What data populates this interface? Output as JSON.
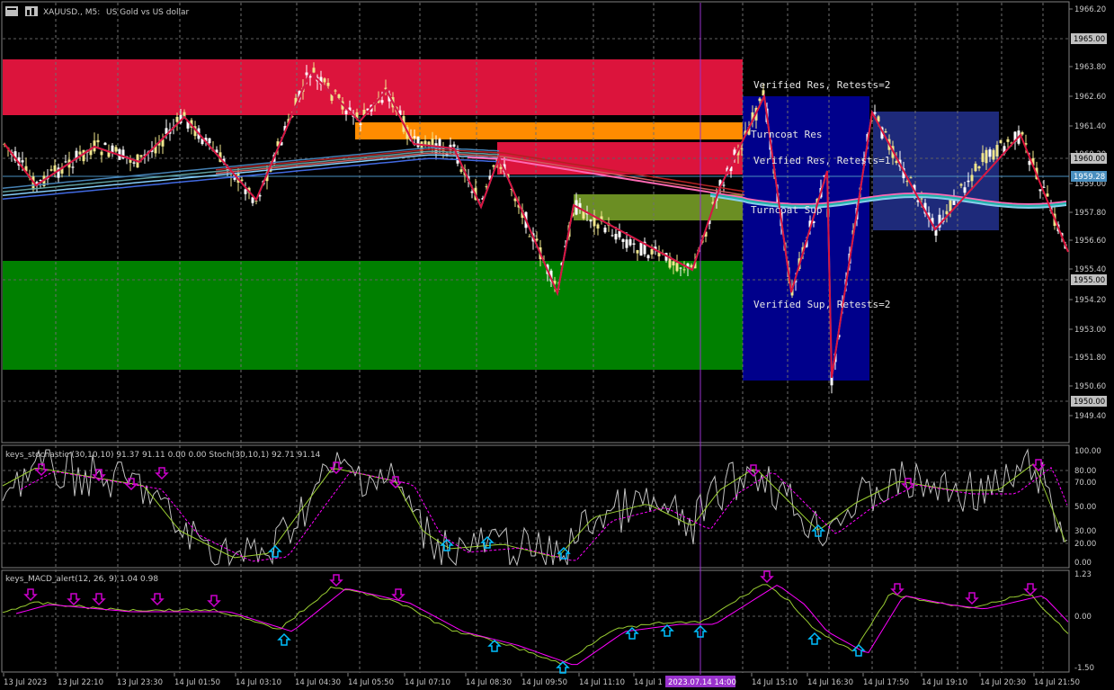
{
  "header": {
    "symbol": "XAUUSD., M5:",
    "description": "US Gold vs US dollar"
  },
  "price_axis": {
    "ticks": [
      "1966.20",
      "1963.80",
      "1962.60",
      "1961.40",
      "1960.20",
      "1959.00",
      "1957.80",
      "1956.60",
      "1955.40",
      "1954.20",
      "1953.00",
      "1951.80",
      "1950.60",
      "1949.40"
    ],
    "level_boxes": [
      "1965.00",
      "1960.00",
      "1955.00",
      "1950.00"
    ],
    "current_price": "1959.28",
    "current_price_color": "#4a8fbf"
  },
  "zones": {
    "verified_res": "Verified Res, Retests=2",
    "turncoat_res": "Turncoat Res",
    "verified_res_2": "Verified Res, Retests=1",
    "turncoat_sup": "Turncoat Sup",
    "verified_sup": "Verified Sup, Retests=2"
  },
  "stochastic": {
    "title": "keys_stochastic (30,10,10) 91.37 91.11 0.00 0.00 Stoch(30,10,1) 92.71 91.14",
    "ticks": [
      "100.00",
      "80.00",
      "70.00",
      "50.00",
      "30.00",
      "20.00",
      "0.00"
    ]
  },
  "macd": {
    "title": "keys_MACD_alert(12, 26, 9) 1.04 0.98",
    "ticks": [
      "1.23",
      "0.00",
      "-1.50"
    ]
  },
  "time_axis": {
    "labels": [
      "13 Jul 2023",
      "13 Jul 22:10",
      "13 Jul 23:30",
      "14 Jul 01:50",
      "14 Jul 03:10",
      "14 Jul 04:30",
      "14 Jul 05:50",
      "14 Jul 07:10",
      "14 Jul 08:30",
      "14 Jul 09:50",
      "14 Jul 11:10",
      "14 Jul 1",
      "14 Jul 15:10",
      "14 Jul 16:30",
      "14 Jul 17:50",
      "14 Jul 19:10",
      "14 Jul 20:30",
      "14 Jul 21:50"
    ],
    "crosshair_label": "2023.07.14 14:00"
  },
  "colors": {
    "resistance": "#dc143c",
    "turncoat_res": "#ff8c00",
    "support": "#008000",
    "turncoat_sup": "#6b8e23",
    "verified_box": "#00008b",
    "crosshair": "#9932cc",
    "zigzag_up": "#1e90ff",
    "zigzag_down": "#dc143c",
    "buy_arrow": "#00bfff",
    "sell_arrow": "#cc00cc"
  }
}
